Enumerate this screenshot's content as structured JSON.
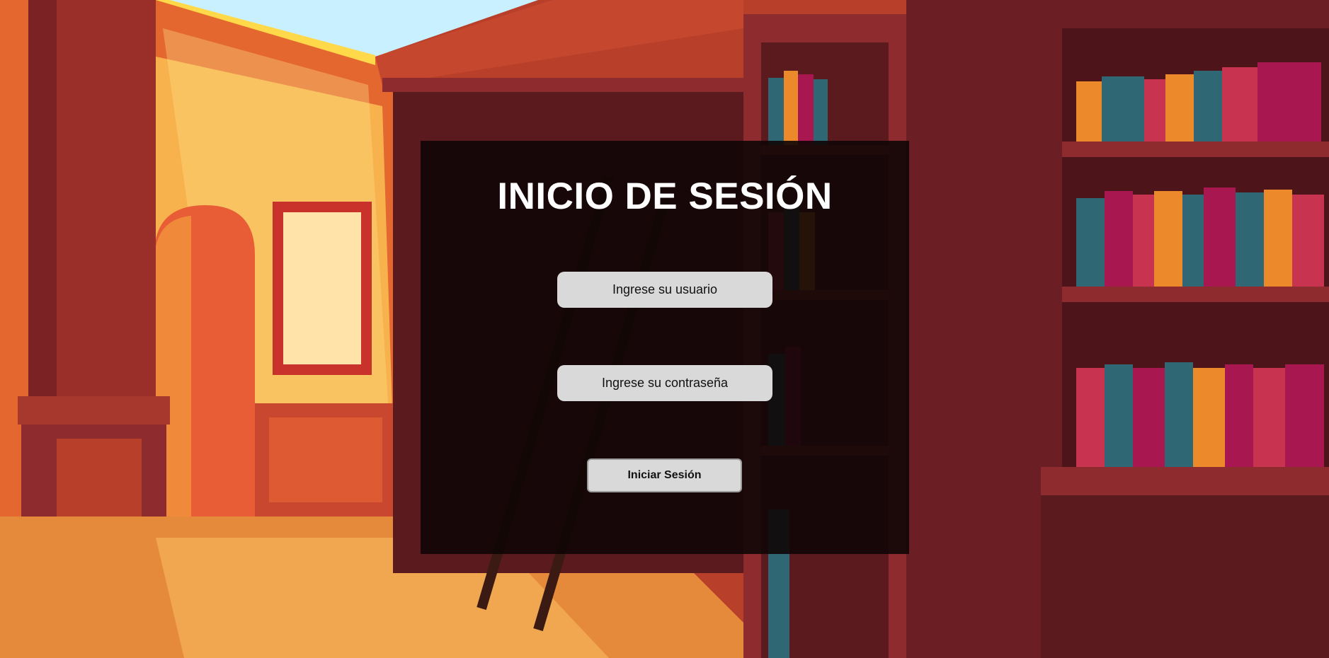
{
  "background": {
    "scene": "library-illustration",
    "colors": {
      "sky": "#c9f0ff",
      "sunlight": "#ffd94a",
      "wall_light": "#f7b24d",
      "wall_orange": "#e3672f",
      "wall_red": "#b8402b",
      "wood_dark": "#6b1f24",
      "shelf": "#8e2b2f",
      "floor": "#e58a3a",
      "book_teal": "#2f6774",
      "book_magenta": "#a8174f",
      "book_orange": "#ec8a2b",
      "book_pink": "#c8334f"
    }
  },
  "login": {
    "title": "INICIO DE SESIÓN",
    "username": {
      "value": "",
      "placeholder": "Ingrese su usuario"
    },
    "password": {
      "value": "",
      "placeholder": "Ingrese su contraseña"
    },
    "submit_label": "Iniciar Sesión"
  }
}
